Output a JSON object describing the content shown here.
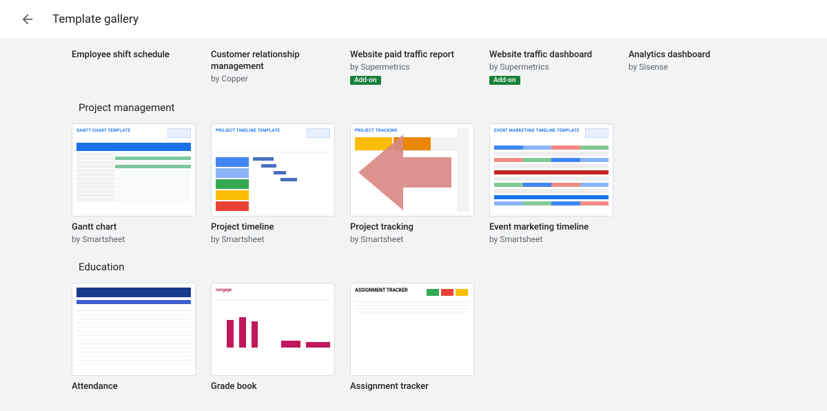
{
  "header": {
    "title": "Template gallery"
  },
  "top_row": [
    {
      "title": "Employee shift schedule",
      "author": "",
      "addon": false
    },
    {
      "title": "Customer relationship management",
      "author": "by Copper",
      "addon": false
    },
    {
      "title": "Website paid traffic report",
      "author": "by Supermetrics",
      "addon": true
    },
    {
      "title": "Website traffic dashboard",
      "author": "by Supermetrics",
      "addon": true
    },
    {
      "title": "Analytics dashboard",
      "author": "by Sisense",
      "addon": false
    }
  ],
  "addon_label": "Add-on",
  "sections": {
    "project_mgmt": {
      "title": "Project management",
      "items": [
        {
          "title": "Gantt chart",
          "author": "by Smartsheet",
          "thumbtitle": "GANTT CHART TEMPLATE"
        },
        {
          "title": "Project timeline",
          "author": "by Smartsheet",
          "thumbtitle": "PROJECT TIMELINE TEMPLATE"
        },
        {
          "title": "Project tracking",
          "author": "by Smartsheet",
          "thumbtitle": "PROJECT TRACKING"
        },
        {
          "title": "Event marketing timeline",
          "author": "by Smartsheet",
          "thumbtitle": "EVENT MARKETING TIMELINE TEMPLATE"
        }
      ]
    },
    "education": {
      "title": "Education",
      "items": [
        {
          "title": "Attendance",
          "author": ""
        },
        {
          "title": "Grade book",
          "author": "",
          "thumbhead": "cengage"
        },
        {
          "title": "Assignment tracker",
          "author": "",
          "thumbhead": "ASSIGNMENT TRACKER"
        }
      ]
    }
  }
}
